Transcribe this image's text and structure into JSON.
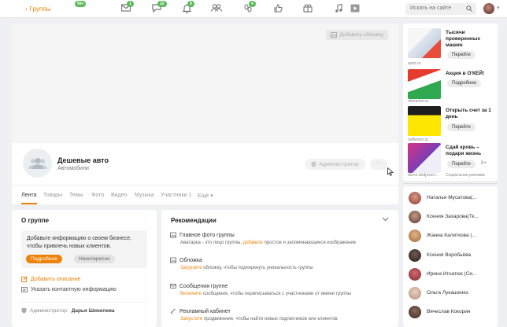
{
  "header": {
    "back_label": "Группы",
    "games_badge": "99+",
    "nav": [
      {
        "icon": "mail-icon",
        "badge": "1"
      },
      {
        "icon": "discussions-icon",
        "badge": "32"
      },
      {
        "icon": "bell-icon",
        "badge": "9"
      },
      {
        "icon": "friends-icon",
        "badge": ""
      },
      {
        "icon": "guests-icon",
        "badge": "4"
      },
      {
        "icon": "like-icon",
        "badge": ""
      },
      {
        "icon": "gifts-icon",
        "badge": ""
      },
      {
        "icon": "music-icon",
        "badge": ""
      },
      {
        "icon": "video-icon",
        "badge": ""
      }
    ],
    "search_placeholder": "Искать на сайте"
  },
  "group": {
    "cover_button": "Добавить обложку",
    "name": "Дешевые авто",
    "category": "Автомобили",
    "admin_button": "Администратор",
    "more_button": "···",
    "tabs": [
      "Лента",
      "Товары",
      "Темы",
      "Фото",
      "Видео",
      "Музыка",
      "Участники 1",
      "Ещё"
    ]
  },
  "about": {
    "title": "О группе",
    "info_text": "Добавьте информацию о своем бизнесе, чтобы привлечь новых клиентов.",
    "btn_more": "Подробнее",
    "btn_not_interested": "Неинтересно",
    "add_description": "Добавить описание",
    "add_contact": "Указать контактную информацию",
    "admin_label": "Администратор:",
    "admin_name": "Дарья Шикилева"
  },
  "recommendations": {
    "title": "Рекомендации",
    "items": [
      {
        "title": "Главное фото группы",
        "desc_before": "Аватарка - это лицо группы, ",
        "desc_link": "добавьте",
        "desc_after": " простое и запоминающееся изображение"
      },
      {
        "title": "Обложка",
        "desc_before": "",
        "desc_link": "Загрузите",
        "desc_after": " обложку, чтобы подчеркнуть уникальность группы"
      },
      {
        "title": "Сообщения группе",
        "desc_before": "",
        "desc_link": "Включите",
        "desc_after": " сообщения, чтобы переписываться с участниками от имени группы"
      },
      {
        "title": "Рекламный кабинет",
        "desc_before": "",
        "desc_link": "Запустите",
        "desc_after": " продвижение, чтобы найти новых подписчиков или клиентов"
      }
    ]
  },
  "ads": [
    {
      "title": "Тысячи проверенных машин",
      "source": "avito.ru",
      "button": "Перейти",
      "age": ""
    },
    {
      "title": "Акция в О'КЕЙ!",
      "source": "okmarket.ru",
      "button": "Подробнее",
      "age": ""
    },
    {
      "title": "Открыть счет за 1 день",
      "source": "raiffeisen.ru",
      "button": "Перейти",
      "age": ""
    },
    {
      "title": "Сдай кровь – подари жизнь",
      "source": "donor.dodjovert...",
      "button": "Перейти",
      "age": "0+"
    }
  ],
  "ads_footer": "Социальная реклама",
  "members": [
    "Наталья Мусатова(...",
    "Ксения Захарова(Тк...",
    "Жанна Калиткова (...",
    "Ксения Воробьёва",
    "Ирина Игнатюк (Си...",
    "Ольга Лукашенко",
    "Вячеслав Кокорин"
  ]
}
